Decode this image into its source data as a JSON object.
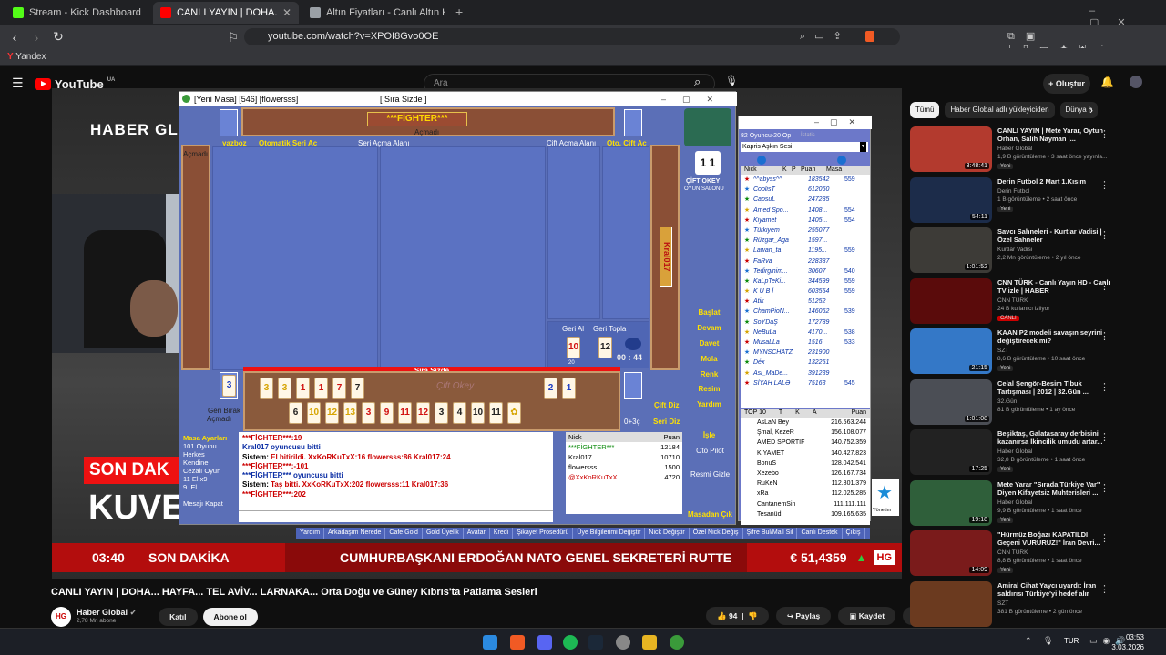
{
  "browser": {
    "tabs": [
      {
        "label": "Stream - Kick Dashboard",
        "favicon_color": "#53fc18"
      },
      {
        "label": "CANLI YAYIN | DOHA... HAYFA...",
        "favicon_color": "#ff0000"
      },
      {
        "label": "Altın Fiyatları - Canlı Altın Kuru ve Al",
        "favicon_color": "#9aa0a6"
      }
    ],
    "url": "youtube.com/watch?v=XPOI8Gvo0OE",
    "bookmark": "Yandex"
  },
  "youtube": {
    "logo": "YouTube",
    "logo_region": "UA",
    "search_placeholder": "Ara",
    "create_label": "Oluştur",
    "video_title": "CANLI YAYIN | DOHA... HAYFA... TEL AVİV... LARNAKA... Orta Doğu ve Güney Kıbrıs'ta Patlama Sesleri",
    "channel": {
      "name": "Haber Global",
      "subs": "2,78 Mn abone",
      "join": "Katıl",
      "subscribe": "Abone ol",
      "avatar": "HG"
    },
    "actions": {
      "likes": "94",
      "share": "Paylaş",
      "save": "Kaydet"
    }
  },
  "video": {
    "channel_logo": "HABER GL",
    "headline_partial": "KUVE",
    "son_dakika_box": "SON DAK",
    "ticker": {
      "time": "03:40",
      "label": "SON DAKİKA",
      "message": "CUMHURBAŞKANI ERDOĞAN NATO GENEL SEKRETERİ RUTTE İLE GÖRÜŞTÜ",
      "currency": "€  51,4359",
      "logo": "HG"
    }
  },
  "game": {
    "title": "[Yeni Masa] [546] [flowersss]",
    "turn_title": "[ Sıra Sizde ]",
    "top_player": "***FİGHTER***",
    "top_player_status": "Açmadı",
    "labels": {
      "yazboz": "yazboz",
      "auto_series": "Otomatik Seri Aç",
      "series_area": "Seri Açma Alanı",
      "pair_area": "Çift Açma Alanı",
      "auto_pair": "Oto. Çift Aç",
      "left_status": "Açmadı",
      "back_take": "Geri Al",
      "back_take_count": "20",
      "collect": "Geri Topla",
      "timer": "00 : 44",
      "rack_header": "Sıra Sizde",
      "rack_watermark": "Çift Okey",
      "discard_label": "Geri Bırak",
      "discard_status": "Açmadı",
      "score": "0+3ç",
      "pair_indicator": "Çift Diz",
      "series_indicator": "Seri Diz"
    },
    "right_player": "Kral017",
    "brand": "ÇİFT OKEY",
    "brand_sub": "OYUN SALONU",
    "right_menu": [
      "Başlat",
      "Devam",
      "Davet",
      "Mola",
      "Renk",
      "Resim",
      "Yardım",
      "",
      "İşle"
    ],
    "masa": [
      "Masa Ayarları",
      "101 Oyunu",
      "Herkes Kendine",
      "Cezalı Oyun",
      "11 El x9",
      "9. El",
      "",
      "Mesajı Kapat"
    ],
    "chat": [
      {
        "c": "red",
        "t": "***FİGHTER***:19"
      },
      {
        "c": "blue",
        "t": "Kral017 oyuncusu  bitti"
      },
      {
        "c": "mix",
        "a": "Sistem: ",
        "t": "El bitirildi. XxKoRKuTxX:16 flowersss:86 Kral017:24"
      },
      {
        "c": "red",
        "t": "***FİGHTER***:-101"
      },
      {
        "c": "blue",
        "t": "***FİGHTER*** oyuncusu  bitti"
      },
      {
        "c": "mix",
        "a": "Sistem: ",
        "t": "Taş bitti. XxKoRKuTxX:202 flowersss:11 Kral017:36"
      },
      {
        "c": "red",
        "t": "***FİGHTER***:202"
      }
    ],
    "players_header": {
      "nick": "Nick",
      "puan": "Puan"
    },
    "players": [
      {
        "nick": "***FİGHTER***",
        "puan": "12184"
      },
      {
        "nick": "Kral017",
        "puan": "10710"
      },
      {
        "nick": "flowersss",
        "puan": "1500"
      },
      {
        "nick": "@XxKoRKuTxX",
        "puan": "4720"
      }
    ],
    "side_buttons": [
      "Oto Pilot",
      "Resmi Gizle",
      "Masadan Çık"
    ],
    "rack_top": [
      [
        "3",
        "y"
      ],
      [
        "3",
        "y"
      ],
      [
        "1",
        "r"
      ],
      [
        "1",
        "r"
      ],
      [
        "7",
        "r"
      ],
      [
        "7",
        "k"
      ],
      [
        "2",
        "b"
      ],
      [
        "1",
        "b"
      ]
    ],
    "rack_bottom": [
      [
        "6",
        "k"
      ],
      [
        "10",
        "y"
      ],
      [
        "12",
        "y"
      ],
      [
        "13",
        "y"
      ],
      [
        "3",
        "r"
      ],
      [
        "9",
        "r"
      ],
      [
        "11",
        "r"
      ],
      [
        "12",
        "r"
      ],
      [
        "3",
        "k"
      ],
      [
        "4",
        "k"
      ],
      [
        "10",
        "k"
      ],
      [
        "11",
        "k"
      ],
      [
        "✿",
        "y"
      ]
    ],
    "indicator_tile": "3",
    "discard_tile": "10",
    "okey_tile": "12",
    "bottom_links": [
      "Yardım",
      "Arkadaşım Nerede",
      "Cafe Gold",
      "Gold Üyelik",
      "Avatar",
      "Kredi",
      "Şikayet Prosedürü",
      "Üye Bilgilerimi Değiştir",
      "Nick Değiştir",
      "Özel Nick Değiş",
      "Şifre Bul/Mail Sil",
      "Canlı Destek",
      "Çıkış"
    ]
  },
  "lobby": {
    "room": "82 Oyuncu-20 Op",
    "room_hint": "İstatis",
    "dropdown": "Kapris Aşkın Sesi",
    "headers": {
      "nick": "Nick",
      "k": "K",
      "p": "P",
      "puan": "Puan",
      "masa": "Masa"
    },
    "list": [
      [
        "^^abyss^^",
        "183542",
        "559"
      ],
      [
        "CoolisT",
        "612060",
        ""
      ],
      [
        "CapsuL",
        "247285",
        ""
      ],
      [
        "Amed Spo...",
        "1408...",
        "554"
      ],
      [
        "Kiyamet",
        "1405...",
        "554"
      ],
      [
        "Türkiyem",
        "255077",
        ""
      ],
      [
        "Rüzgar_Aga",
        "1597...",
        ""
      ],
      [
        "Lawan_ta",
        "1195...",
        "559"
      ],
      [
        "FaRva",
        "228387",
        ""
      ],
      [
        "Tedirginim...",
        "30607",
        "540"
      ],
      [
        "KaLpTeKi...",
        "344599",
        "559"
      ],
      [
        "K U B İ",
        "603554",
        "559"
      ],
      [
        "Atik",
        "51252",
        ""
      ],
      [
        "ChamPioN...",
        "146062",
        "539"
      ],
      [
        "SoYDaŞ",
        "172789",
        ""
      ],
      [
        "NeBuLa",
        "4170...",
        "538"
      ],
      [
        "MusaLLa",
        "1516",
        "533"
      ],
      [
        "MYNSCHATZ",
        "231900",
        ""
      ],
      [
        "Déx",
        "132251",
        ""
      ],
      [
        "Asl_MaDe...",
        "391239",
        ""
      ],
      [
        "SİYAH LALƏ",
        "75163",
        "545"
      ]
    ],
    "top10_label": "TOP 10",
    "top10_head": {
      "t": "T",
      "k": "K",
      "a": "A",
      "puan": "Puan"
    },
    "top10": [
      [
        "AsLaN Bey",
        "216.563.244"
      ],
      [
        "Şmal, KezeR",
        "156.108.077"
      ],
      [
        "AMED SPORTIF",
        "140.752.359"
      ],
      [
        "KIYAMET",
        "140.427.823"
      ],
      [
        "BonuS",
        "128.042.541"
      ],
      [
        "Xezebo",
        "126.167.734"
      ],
      [
        "RuKeN",
        "112.801.379"
      ],
      [
        "xRa",
        "112.025.285"
      ],
      [
        "CantanemSin",
        "111.111.111"
      ],
      [
        "Tesanüd",
        "109.165.635"
      ]
    ],
    "footer": "Yönetim"
  },
  "sidebar": {
    "chips": [
      "Tümü",
      "Haber Global adlı yükleyiciden",
      "Dünya h"
    ],
    "videos": [
      {
        "title": "CANLI YAYIN | Mete Yarar, Oytun Orhan, Salih Nayman |...",
        "channel": "Haber Global",
        "meta": "1,9 B görüntüleme • 3 saat önce yayınla...",
        "badge": "Yeni",
        "dur": "3:48:41",
        "thumb": "#b33a2e"
      },
      {
        "title": "Derin Futbol 2 Mart 1.Kısım",
        "channel": "Derin Futbol",
        "meta": "1 B görüntüleme • 2 saat önce",
        "badge": "Yeni",
        "dur": "54:11",
        "thumb": "#1c2c4a"
      },
      {
        "title": "Savcı Sahneleri - Kurtlar Vadisi | Özel Sahneler",
        "channel": "Kurtlar Vadisi",
        "meta": "2,2 Mn görüntüleme • 2 yıl önce",
        "badge": "",
        "dur": "1:01:52",
        "thumb": "#3d3b37"
      },
      {
        "title": "CNN TÜRK - Canlı Yayın HD - Canlı TV izle | HABER",
        "channel": "CNN TÜRK",
        "meta": "24 B kullanıcı izliyor",
        "badge": "CANLI",
        "dur": "",
        "thumb": "#5a0b0b"
      },
      {
        "title": "KAAN P2 modeli savaşın seyrini değiştirecek mi?",
        "channel": "SZT",
        "meta": "8,6 B görüntüleme • 10 saat önce",
        "badge": "Yeni",
        "dur": "21:15",
        "thumb": "#3478c7"
      },
      {
        "title": "Celal Şengör-Besim Tibuk Tartışması | 2012 | 32.Gün ...",
        "channel": "32.Gün",
        "meta": "81 B görüntüleme • 1 ay önce",
        "badge": "",
        "dur": "1:01:08",
        "thumb": "#4b4e55"
      },
      {
        "title": "Beşiktaş, Galatasaray derbisini kazanırsa İkincilik umudu artar...",
        "channel": "Haber Global",
        "meta": "32,8 B görüntüleme • 1 saat önce",
        "badge": "Yeni",
        "dur": "17:25",
        "thumb": "#222"
      },
      {
        "title": "Mete Yarar \"Sırada Türkiye Var\" Diyen Kifayetsiz Muhterisleri ...",
        "channel": "Haber Global",
        "meta": "9,9 B görüntüleme • 1 saat önce",
        "badge": "Yeni",
        "dur": "19:18",
        "thumb": "#2f5f3a"
      },
      {
        "title": "\"Hürmüz Boğazı KAPATILDI Geçeni VURURUZ!\" İran Devri...",
        "channel": "CNN TÜRK",
        "meta": "8,8 B görüntüleme • 1 saat önce",
        "badge": "Yeni",
        "dur": "14:09",
        "thumb": "#7a1b1b"
      },
      {
        "title": "Amiral Cihat Yaycı uyardı: İran saldırısı Türkiye'yi hedef alır",
        "channel": "SZT",
        "meta": "381 B görüntüleme • 2 gün önce",
        "badge": "",
        "dur": "",
        "thumb": "#6b3a1f"
      }
    ]
  },
  "taskbar": {
    "lang": "TUR",
    "time": "03:53",
    "date": "3.03.2026"
  }
}
